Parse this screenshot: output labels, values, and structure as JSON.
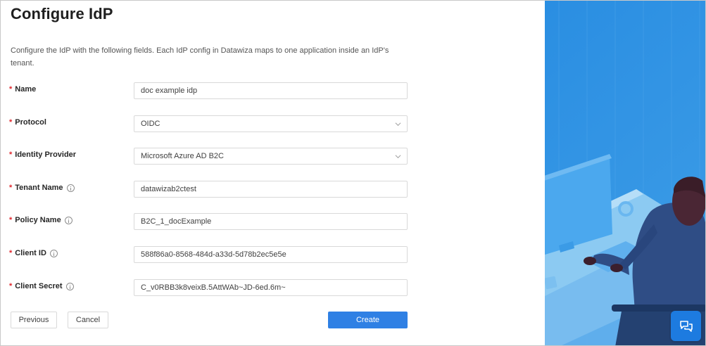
{
  "page": {
    "title": "Configure IdP",
    "description": "Configure the IdP with the following fields. Each IdP config in Datawiza maps to one application inside an IdP's tenant."
  },
  "form": {
    "name": {
      "label": "Name",
      "value": "doc example idp"
    },
    "protocol": {
      "label": "Protocol",
      "value": "OIDC"
    },
    "identity_provider": {
      "label": "Identity Provider",
      "value": "Microsoft Azure AD B2C"
    },
    "tenant_name": {
      "label": "Tenant Name",
      "value": "datawizab2ctest"
    },
    "policy_name": {
      "label": "Policy Name",
      "value": "B2C_1_docExample"
    },
    "client_id": {
      "label": "Client ID",
      "value": "588f86a0-8568-484d-a33d-5d78b2ec5e5e"
    },
    "client_secret": {
      "label": "Client Secret",
      "value": "C_v0RBB3k8veixB.5AttWAb~JD-6ed.6m~"
    }
  },
  "actions": {
    "previous_label": "Previous",
    "cancel_label": "Cancel",
    "create_label": "Create"
  },
  "icons": {
    "info": "info-circle-icon",
    "chevron": "chevron-down-icon",
    "chat": "chat-bubbles-icon"
  },
  "colors": {
    "primary": "#2f80e4",
    "required": "#e0282e",
    "illustration_background": "#2d8fe0"
  }
}
